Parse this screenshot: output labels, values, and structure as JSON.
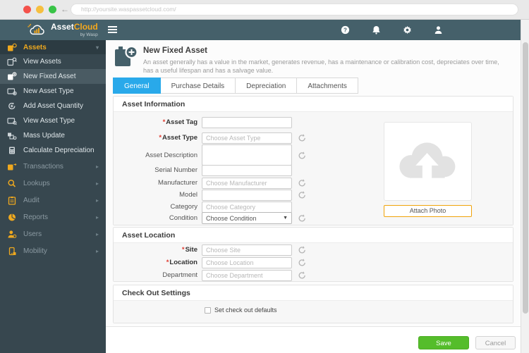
{
  "browser": {
    "url": "http://yoursite.waspassetcloud.com/"
  },
  "appbar": {
    "brand": {
      "name_part1": "Asset",
      "name_part2": "Cloud",
      "byline": "by Wasp"
    },
    "icons": [
      {
        "name": "help"
      },
      {
        "name": "notifications"
      },
      {
        "name": "settings"
      },
      {
        "name": "user"
      }
    ]
  },
  "sidebar": {
    "items": [
      {
        "label": "Assets",
        "state": "expanded",
        "chevron": "down"
      },
      {
        "label": "View Assets"
      },
      {
        "label": "New Fixed Asset",
        "state": "selected"
      },
      {
        "label": "New Asset Type"
      },
      {
        "label": "Add Asset Quantity"
      },
      {
        "label": "View Asset Type"
      },
      {
        "label": "Mass Update"
      },
      {
        "label": "Calculate Depreciation"
      },
      {
        "label": "Transactions",
        "chevron": "right"
      },
      {
        "label": "Lookups",
        "chevron": "right"
      },
      {
        "label": "Audit",
        "chevron": "right"
      },
      {
        "label": "Reports",
        "chevron": "right"
      },
      {
        "label": "Users",
        "chevron": "right"
      },
      {
        "label": "Mobility",
        "chevron": "right"
      }
    ]
  },
  "page": {
    "title": "New Fixed Asset",
    "description_line1": "An asset generally has a value in the market, generates revenue, has a maintenance or calibration cost, depreciates over time,",
    "description_line2": "has a useful lifespan and has a salvage value.",
    "tabs": [
      {
        "label": "General",
        "active": true
      },
      {
        "label": "Purchase Details",
        "active": false
      },
      {
        "label": "Depreciation",
        "active": false
      },
      {
        "label": "Attachments",
        "active": false
      }
    ]
  },
  "asset_information": {
    "title": "Asset Information",
    "fields": [
      {
        "mark": "*",
        "label": "Asset Tag",
        "value": "",
        "placeholder": ""
      },
      {
        "mark": "*",
        "label": "Asset Type",
        "value": "",
        "placeholder": "Choose Asset Type"
      },
      {
        "mark": "",
        "label": "Asset Description",
        "value": "",
        "placeholder": ""
      },
      {
        "mark": "",
        "label": "Serial Number",
        "value": "",
        "placeholder": ""
      },
      {
        "mark": "",
        "label": "Manufacturer",
        "value": "",
        "placeholder": "Choose Manufacturer"
      },
      {
        "mark": "",
        "label": "Model",
        "value": "",
        "placeholder": ""
      },
      {
        "mark": "",
        "label": "Category",
        "value": "",
        "placeholder": "Choose Category"
      },
      {
        "mark": "",
        "label": "Condition",
        "value": "Choose Condition"
      }
    ],
    "attach_photo_label": "Attach Photo"
  },
  "asset_location": {
    "title": "Asset Location",
    "fields": [
      {
        "mark": "*",
        "label": "Site",
        "placeholder": "Choose Site"
      },
      {
        "mark": "*",
        "label": "Location",
        "placeholder": "Choose Location"
      },
      {
        "mark": "",
        "label": "Department",
        "placeholder": "Choose Department"
      }
    ]
  },
  "check_out": {
    "title": "Check Out Settings",
    "checkbox_label": "Set check out defaults",
    "checked": false
  },
  "footer": {
    "save_label": "Save",
    "cancel_label": "Cancel"
  },
  "colors": {
    "appbar": "#45606a",
    "sidebar": "#37474f",
    "accent_yellow": "#f0a91e",
    "tab_active_blue": "#29a9ea",
    "save_green": "#55bd2b",
    "attach_border_orange": "#f0a30a"
  }
}
